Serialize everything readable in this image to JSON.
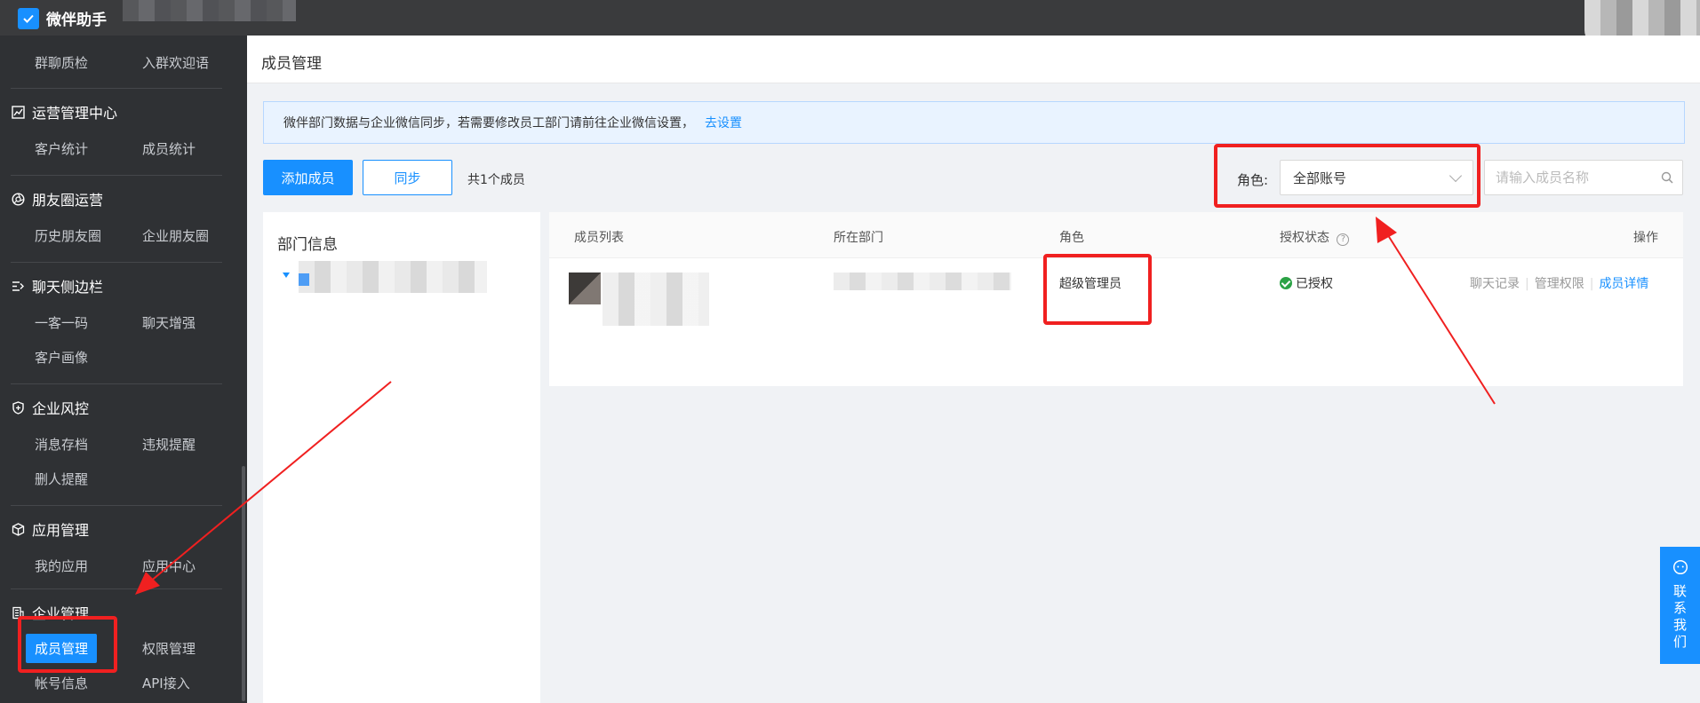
{
  "app": {
    "name": "微伴助手"
  },
  "sidebar": {
    "top_items": [
      "群聊质检",
      "入群欢迎语"
    ],
    "groups": [
      {
        "title": "运营管理中心",
        "icon": "chart-icon",
        "items": [
          "客户统计",
          "成员统计"
        ]
      },
      {
        "title": "朋友圈运营",
        "icon": "aperture-icon",
        "items": [
          "历史朋友圈",
          "企业朋友圈"
        ]
      },
      {
        "title": "聊天侧边栏",
        "icon": "sidebar-arrow-icon",
        "items": [
          "一客一码",
          "聊天增强",
          "客户画像"
        ]
      },
      {
        "title": "企业风控",
        "icon": "shield-icon",
        "items": [
          "消息存档",
          "违规提醒",
          "删人提醒"
        ]
      },
      {
        "title": "应用管理",
        "icon": "cube-icon",
        "items": [
          "我的应用",
          "应用中心"
        ]
      },
      {
        "title": "企业管理",
        "icon": "building-icon",
        "items": [
          "成员管理",
          "权限管理",
          "帐号信息",
          "API接入"
        ]
      }
    ],
    "active_item": "成员管理"
  },
  "page": {
    "title": "成员管理"
  },
  "notice": {
    "text": "微伴部门数据与企业微信同步，若需要修改员工部门请前往企业微信设置，",
    "link": "去设置"
  },
  "toolbar": {
    "add_label": "添加成员",
    "sync_label": "同步",
    "count_text": "共1个成员",
    "role_label": "角色:",
    "role_selected": "全部账号",
    "search_placeholder": "请输入成员名称"
  },
  "dept_panel": {
    "title": "部门信息"
  },
  "table": {
    "headers": {
      "members": "成员列表",
      "department": "所在部门",
      "role": "角色",
      "auth_status": "授权状态",
      "actions": "操作"
    },
    "rows": [
      {
        "role": "超级管理员",
        "status": "已授权",
        "actions": [
          "聊天记录",
          "管理权限",
          "成员详情"
        ]
      }
    ]
  },
  "float_contact": {
    "chars": [
      "联",
      "系",
      "我",
      "们"
    ]
  },
  "colors": {
    "primary": "#1890ff",
    "sidebar_bg": "#2f3134",
    "annotation_red": "#f02020",
    "success": "#2ba245"
  }
}
